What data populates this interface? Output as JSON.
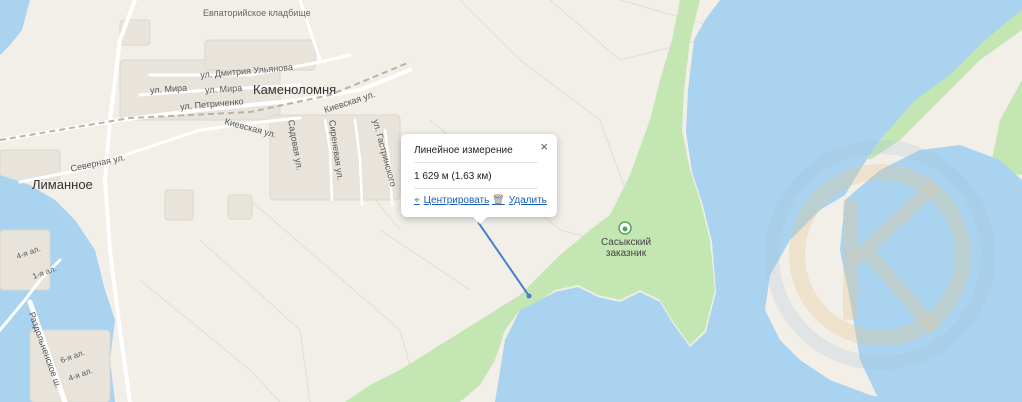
{
  "map": {
    "places": {
      "cemetery": "Евпаторийское кладбище",
      "kamenolomnya": "Каменоломня",
      "limannoe": "Лиманное",
      "reserve": "Сасыкский заказник"
    },
    "streets": {
      "ulyanova": "ул. Дмитрия Ульянова",
      "mira_1": "ул. Мира",
      "mira_2": "ул. Мира",
      "petrichenko": "ул. Петриченко",
      "kievskaya_1": "Киевская ул.",
      "kievskaya_2": "Киевская ул.",
      "severnaya": "Северная ул.",
      "sadovaya": "Садовая ул.",
      "sirenevaya": "Сиреневая ул.",
      "gastrinskogo": "ул. Гастринского",
      "razdolnenskoe": "Раздольненское ш.",
      "lane_4": "4-я ал.",
      "lane_1": "1-я ал.",
      "lane_6": "6-я ал.",
      "lane_4b": "4-я ал."
    },
    "colors": {
      "land": "#f2efe9",
      "water": "#a9d3ee",
      "park": "#c3e6b3",
      "measure_line": "#4a7fd0"
    }
  },
  "popup": {
    "title": "Линейное измерение",
    "distance": "1 629 м (1.63 км)",
    "center_label": "Центрировать",
    "delete_label": "Удалить",
    "close_symbol": "×",
    "center_icon": "center-icon",
    "delete_icon": "trash-icon"
  },
  "watermark": {
    "icon": "logo-k-watermark"
  }
}
